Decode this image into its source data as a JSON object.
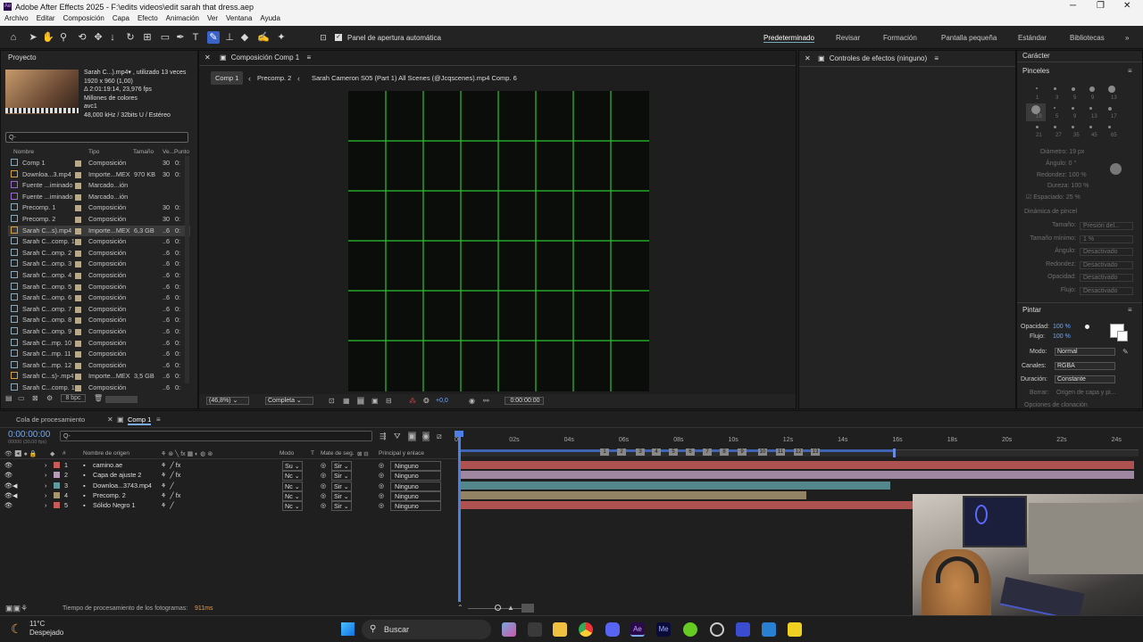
{
  "window": {
    "title": "Adobe After Effects 2025 - F:\\edits videos\\edit sarah that dress.aep"
  },
  "menu": [
    "Archivo",
    "Editar",
    "Composición",
    "Capa",
    "Efecto",
    "Animación",
    "Ver",
    "Ventana",
    "Ayuda"
  ],
  "toolbar": {
    "auto_open_label": "Panel de apertura automática",
    "workspaces": [
      "Predeterminado",
      "Revisar",
      "Formación",
      "Pantalla pequeña",
      "Estándar",
      "Bibliotecas"
    ]
  },
  "project": {
    "title": "Proyecto",
    "footage_name": "Sarah C...).mp4▾ , utilizado 13 veces",
    "info": [
      "1920 x 960 (1,00)",
      "Δ 2:01:19:14, 23,976 fps",
      "Millones de colores",
      "avc1",
      "48,000 kHz / 32bits U / Estéreo"
    ],
    "search_placeholder": "",
    "columns": [
      "Nombre",
      "Tipo",
      "Tamaño",
      "Ve...",
      "Punto"
    ],
    "rows": [
      {
        "name": "Comp 1",
        "type": "Composición",
        "size": "",
        "ver": "30",
        "pt": "0:"
      },
      {
        "name": "Downloa...3.mp4",
        "type": "Importe...MEX",
        "size": "970 KB",
        "ver": "30",
        "pt": "0:"
      },
      {
        "name": "Fuente ...iminado",
        "type": "Marcado...ión",
        "size": "",
        "ver": "",
        "pt": ""
      },
      {
        "name": "Fuente ...iminado",
        "type": "Marcado...ión",
        "size": "",
        "ver": "",
        "pt": ""
      },
      {
        "name": "Precomp. 1",
        "type": "Composición",
        "size": "",
        "ver": "30",
        "pt": "0:"
      },
      {
        "name": "Precomp. 2",
        "type": "Composición",
        "size": "",
        "ver": "30",
        "pt": "0:"
      },
      {
        "name": "Sarah C...s).mp4",
        "type": "Importe...MEX",
        "size": "6,3 GB",
        "ver": "..6",
        "pt": "0:"
      },
      {
        "name": "Sarah C...comp. 1",
        "type": "Composición",
        "size": "",
        "ver": "..6",
        "pt": "0:"
      },
      {
        "name": "Sarah C...omp. 2",
        "type": "Composición",
        "size": "",
        "ver": "..6",
        "pt": "0:"
      },
      {
        "name": "Sarah C...omp. 3",
        "type": "Composición",
        "size": "",
        "ver": "..6",
        "pt": "0:"
      },
      {
        "name": "Sarah C...omp. 4",
        "type": "Composición",
        "size": "",
        "ver": "..6",
        "pt": "0:"
      },
      {
        "name": "Sarah C...omp. 5",
        "type": "Composición",
        "size": "",
        "ver": "..6",
        "pt": "0:"
      },
      {
        "name": "Sarah C...omp. 6",
        "type": "Composición",
        "size": "",
        "ver": "..6",
        "pt": "0:"
      },
      {
        "name": "Sarah C...omp. 7",
        "type": "Composición",
        "size": "",
        "ver": "..6",
        "pt": "0:"
      },
      {
        "name": "Sarah C...omp. 8",
        "type": "Composición",
        "size": "",
        "ver": "..6",
        "pt": "0:"
      },
      {
        "name": "Sarah C...omp. 9",
        "type": "Composición",
        "size": "",
        "ver": "..6",
        "pt": "0:"
      },
      {
        "name": "Sarah C...mp. 10",
        "type": "Composición",
        "size": "",
        "ver": "..6",
        "pt": "0:"
      },
      {
        "name": "Sarah C...mp. 11",
        "type": "Composición",
        "size": "",
        "ver": "..6",
        "pt": "0:"
      },
      {
        "name": "Sarah C...mp. 12",
        "type": "Composición",
        "size": "",
        "ver": "..6",
        "pt": "0:"
      },
      {
        "name": "Sarah C...s)-.mp4",
        "type": "Importe...MEX",
        "size": "3,5 GB",
        "ver": "..6",
        "pt": "0:"
      },
      {
        "name": "Sarah C...comp. 1",
        "type": "Composición",
        "size": "",
        "ver": "..6",
        "pt": "0:"
      }
    ],
    "bpc": "8 bpc"
  },
  "comp": {
    "panel_title": "Composición Comp 1",
    "tabs": [
      "Comp 1",
      "Precomp. 2",
      "Sarah Cameron S05 (Part 1) All Scenes (@Jcqscenes).mp4 Comp. 6"
    ],
    "zoom": "(46,8%)",
    "quality": "Completa",
    "exposure": "+0,0",
    "timecode": "0:00:00:00"
  },
  "effects": {
    "title": "Controles de efectos (ninguno)"
  },
  "right": {
    "caracter": "Carácter",
    "pinceles": "Pinceles",
    "brush_sizes": [
      "1",
      "3",
      "5",
      "9",
      "13",
      "19",
      "5",
      "9",
      "13",
      "17",
      "21",
      "27",
      "35",
      "45",
      "65"
    ],
    "diametro": "Diámetro: 19 px",
    "angulo": "Ángulo: 0 °",
    "redondez": "Redondez: 100 %",
    "dureza": "Dureza: 100 %",
    "espaciado": "Espaciado: 25 %",
    "dinamica": "Dinámica de pincel",
    "props": [
      {
        "l": "Tamaño:",
        "v": "Presión del..."
      },
      {
        "l": "Tamaño mínimo:",
        "v": "1 %"
      },
      {
        "l": "Ángulo:",
        "v": "Desactivado"
      },
      {
        "l": "Redondez:",
        "v": "Desactivado"
      },
      {
        "l": "Opacidad:",
        "v": "Desactivado"
      },
      {
        "l": "Flujo:",
        "v": "Desactivado"
      }
    ],
    "pintar": "Pintar",
    "opacidad_l": "Opacidad:",
    "opacidad_v": "100 %",
    "flujo_l": "Flujo:",
    "flujo_v": "100 %",
    "modo_l": "Modo:",
    "modo_v": "Normal",
    "canales_l": "Canales:",
    "canales_v": "RGBA",
    "duracion_l": "Duración:",
    "duracion_v": "Constante",
    "borrar_l": "Borrar:",
    "borrar_v": "Origen de capa y pi...",
    "clon": "Opciones de clonación"
  },
  "timeline": {
    "tab_queue": "Cola de procesamiento",
    "tab_comp": "Comp 1",
    "timecode": "0:00:00:00",
    "fps": "00000 (30,00 fps)",
    "cols": {
      "name": "Nombre de origen",
      "mode": "Modo",
      "t": "T",
      "mate": "Mate de seg.",
      "parent": "Principal y enlace"
    },
    "layers": [
      {
        "n": "1",
        "name": "camino.ae",
        "mode": "Su",
        "mate": "Sir",
        "parent": "Ninguno",
        "color": "#c75a5a"
      },
      {
        "n": "2",
        "name": "Capa de ajuste 2",
        "mode": "Nc",
        "mate": "Sir",
        "parent": "Ninguno",
        "color": "#b79ab8"
      },
      {
        "n": "3",
        "name": "Downloa...3743.mp4",
        "mode": "Nc",
        "mate": "Sir",
        "parent": "Ninguno",
        "color": "#5e9aa0"
      },
      {
        "n": "4",
        "name": "Precomp. 2",
        "mode": "Nc",
        "mate": "Sir",
        "parent": "Ninguno",
        "color": "#a89572"
      },
      {
        "n": "5",
        "name": "Sólido Negro 1",
        "mode": "Nc",
        "mate": "Sir",
        "parent": "Ninguno",
        "color": "#c75a5a"
      }
    ],
    "ruler": [
      "0s",
      "02s",
      "04s",
      "06s",
      "08s",
      "10s",
      "12s",
      "14s",
      "16s",
      "18s",
      "20s",
      "22s",
      "24s"
    ],
    "markers": [
      "1",
      "2",
      "3",
      "4",
      "5",
      "6",
      "7",
      "8",
      "9",
      "10",
      "11",
      "12",
      "13"
    ],
    "status": "Tiempo de procesamiento de los fotogramas:",
    "status_v": "911ms"
  },
  "taskbar": {
    "temp": "11°C",
    "weather": "Despejado",
    "search": "Buscar"
  }
}
